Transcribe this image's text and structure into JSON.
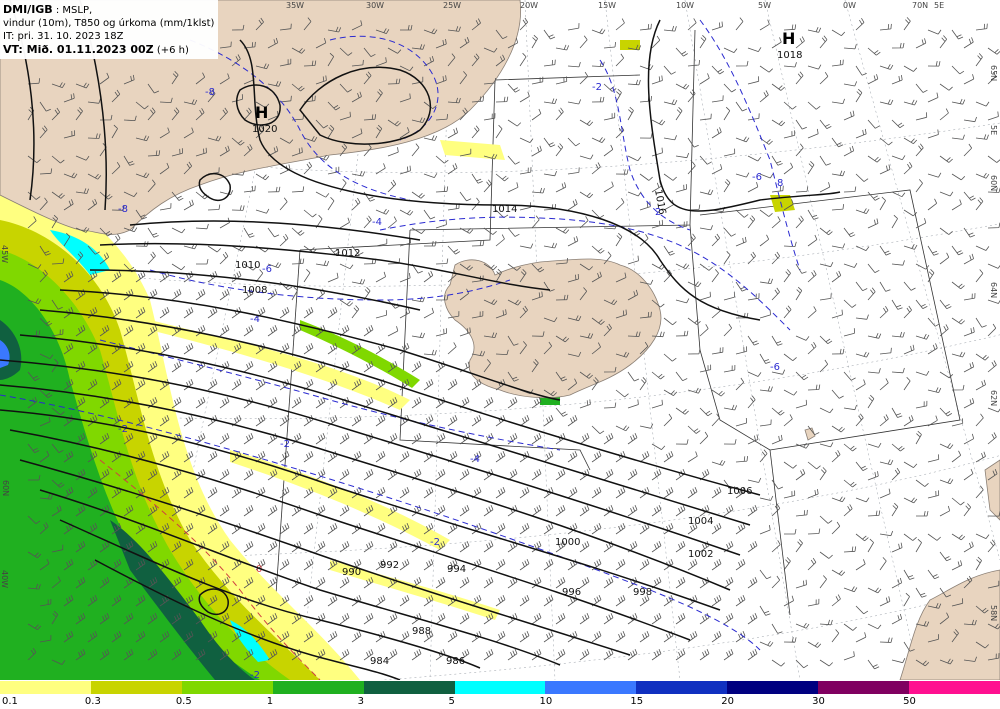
{
  "header": {
    "title": "DMI/IGB",
    "title_rest": " : MSLP,",
    "line2": "vindur (10m), T850 og úrkoma (mm/1klst)",
    "line3": "IT: pri. 31. 10. 2023 18Z",
    "line4_bold": "VT: Mið. 01.11.2023 00Z",
    "line4_rest": " (+6 h)"
  },
  "pressure_centers": [
    {
      "symbol": "H",
      "value": "1020"
    },
    {
      "symbol": "H",
      "value": "1018"
    }
  ],
  "isobars": [
    {
      "label": "1020"
    },
    {
      "label": "1018"
    },
    {
      "label": "1016"
    },
    {
      "label": "1014"
    },
    {
      "label": "1012"
    },
    {
      "label": "1010"
    },
    {
      "label": "1008"
    },
    {
      "label": "1006"
    },
    {
      "label": "1004"
    },
    {
      "label": "1002"
    },
    {
      "label": "1000"
    },
    {
      "label": "998"
    },
    {
      "label": "996"
    },
    {
      "label": "994"
    },
    {
      "label": "992"
    },
    {
      "label": "990"
    },
    {
      "label": "988"
    },
    {
      "label": "986"
    },
    {
      "label": "984"
    }
  ],
  "t850_labels": [
    "-2",
    "-4",
    "-6",
    "-8",
    "2",
    "0"
  ],
  "grid_labels": {
    "lon": [
      "35W",
      "30W",
      "25W",
      "20W",
      "15W",
      "10W",
      "5W",
      "0W",
      "70N",
      "5E",
      "40W",
      "45W"
    ],
    "lat": [
      "60N",
      "65N",
      "5E",
      "64N",
      "62N",
      "60N",
      "58N"
    ]
  },
  "legend": {
    "colors": [
      "#ffff80",
      "#c8d400",
      "#80d800",
      "#20b020",
      "#106040",
      "#00ffff",
      "#3a78ff",
      "#1030c0",
      "#000080",
      "#800060",
      "#ff1090",
      "#ff0000"
    ],
    "labels": [
      "0.1",
      "0.3",
      "0.5",
      "1",
      "3",
      "5",
      "10",
      "15",
      "20",
      "30",
      "50"
    ]
  }
}
